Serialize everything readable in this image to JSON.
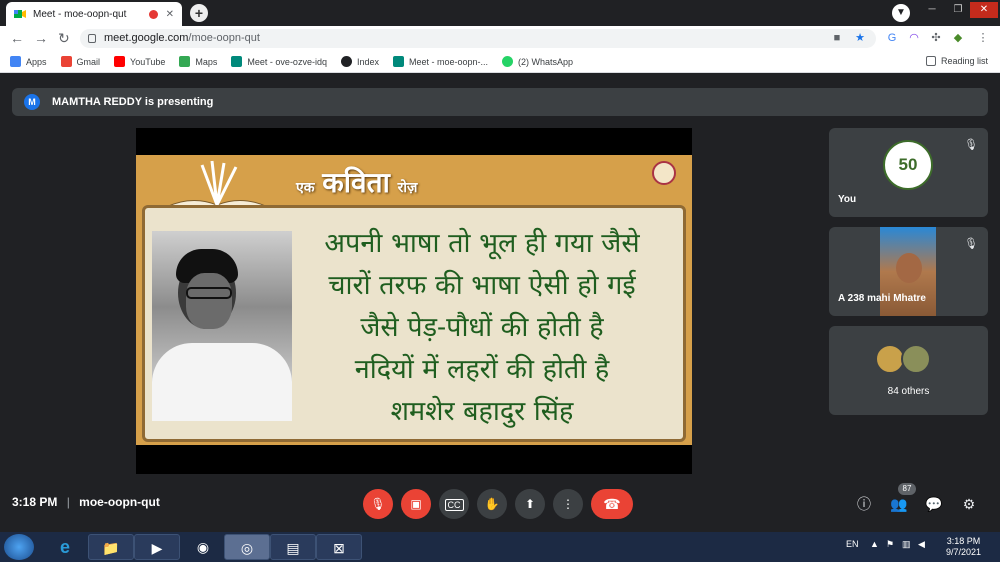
{
  "browser": {
    "tab_title": "Meet - moe-oopn-qut",
    "new_tab": "+",
    "url_host": "meet.google.com",
    "url_path": "/moe-oopn-qut"
  },
  "bookmarks": [
    {
      "label": "Apps",
      "color": "#4285f4"
    },
    {
      "label": "Gmail",
      "color": "#ea4335"
    },
    {
      "label": "YouTube",
      "color": "#ff0000"
    },
    {
      "label": "Maps",
      "color": "#34a853"
    },
    {
      "label": "Meet - ove-ozve-idq",
      "color": "#00897b"
    },
    {
      "label": "Index",
      "color": "#202124"
    },
    {
      "label": "Meet - moe-oopn-...",
      "color": "#00897b"
    },
    {
      "label": "(2) WhatsApp",
      "color": "#25d366"
    }
  ],
  "reading_list": "Reading list",
  "presenting": {
    "avatar": "M",
    "text": "MAMTHA REDDY is presenting"
  },
  "slide": {
    "logo_small": "एक",
    "logo_main": "कविता",
    "logo_suffix": "रोज़",
    "lines": [
      "अपनी भाषा तो भूल ही गया जैसे",
      "चारों तरफ की भाषा ऐसी हो गई",
      "जैसे पेड़-पौधों की होती है",
      "नदियों में लहरों की होती है",
      "शमशेर बहादुर सिंह"
    ]
  },
  "participants": {
    "you_label": "You",
    "badge": "50",
    "other_name": "A 238 mahi Mhatre",
    "others_label": "84 others"
  },
  "meeting": {
    "time": "3:18 PM",
    "separator": "|",
    "code": "moe-oopn-qut",
    "people_count": "87"
  },
  "taskbar": {
    "lang": "EN",
    "time": "3:18 PM",
    "date": "9/7/2021"
  }
}
